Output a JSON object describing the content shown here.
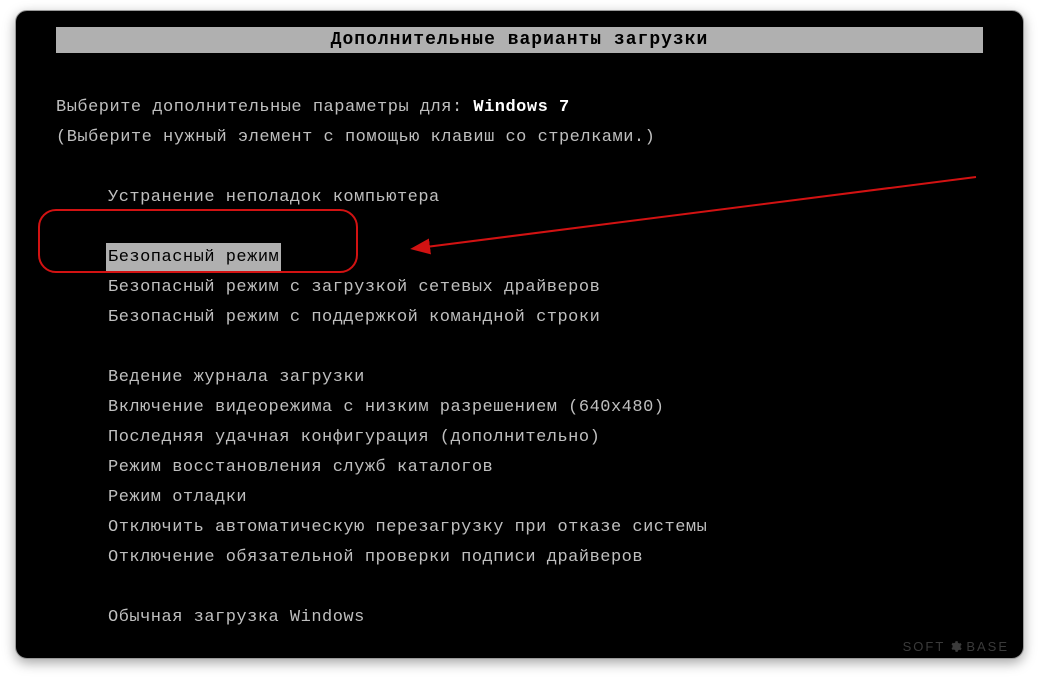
{
  "title": "Дополнительные варианты загрузки",
  "prompt_prefix": "Выберите дополнительные параметры для: ",
  "os_name": "Windows 7",
  "hint": "(Выберите нужный элемент с помощью клавиш со стрелками.)",
  "group1": [
    "Устранение неполадок компьютера"
  ],
  "group2": [
    "Безопасный режим",
    "Безопасный режим с загрузкой сетевых драйверов",
    "Безопасный режим с поддержкой командной строки"
  ],
  "group3": [
    "Ведение журнала загрузки",
    "Включение видеорежима с низким разрешением (640x480)",
    "Последняя удачная конфигурация (дополнительно)",
    "Режим восстановления служб каталогов",
    "Режим отладки",
    "Отключить автоматическую перезагрузку при отказе системы",
    "Отключение обязательной проверки подписи драйверов"
  ],
  "group4": [
    "Обычная загрузка Windows"
  ],
  "selected_index_group2": 0,
  "watermark": {
    "left": "SOFT",
    "right": "BASE"
  }
}
